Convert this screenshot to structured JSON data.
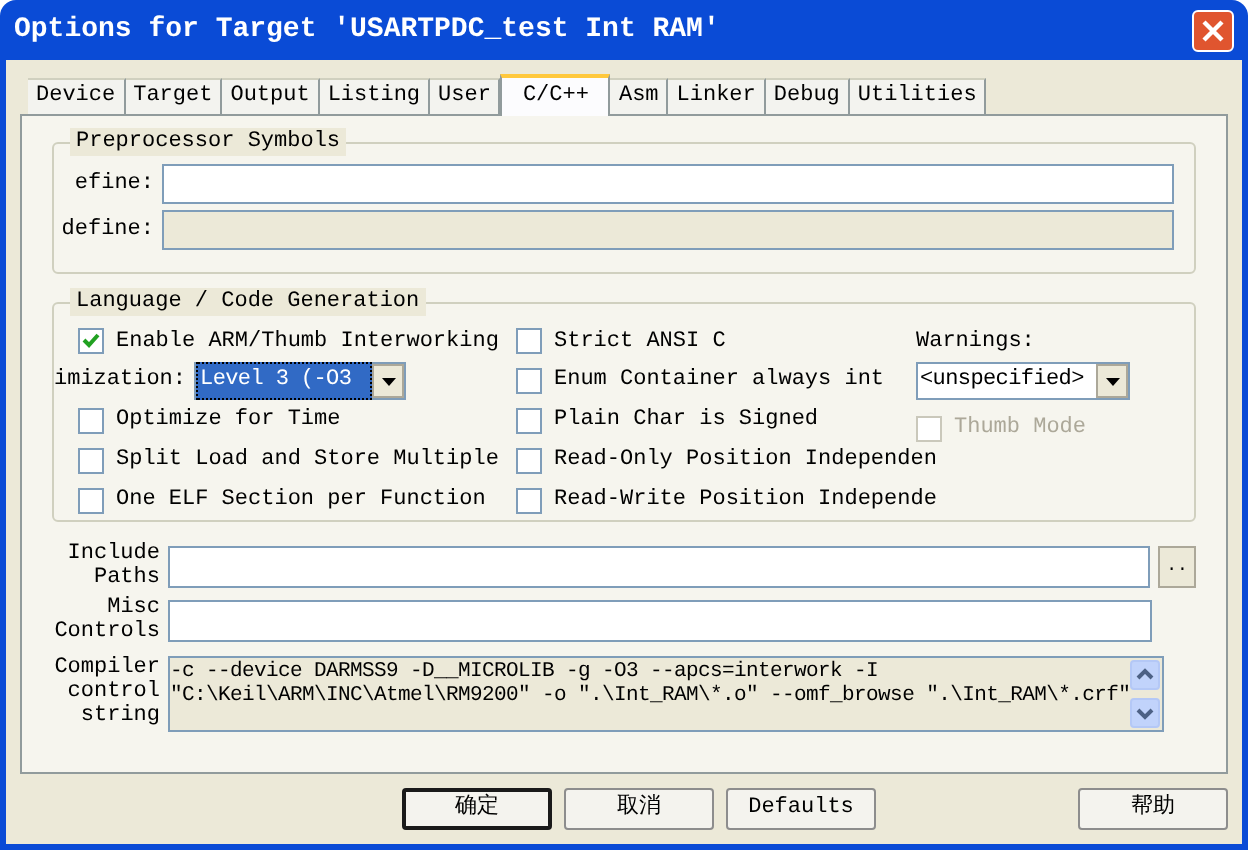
{
  "window": {
    "title": "Options for Target 'USARTPDC_test Int RAM'"
  },
  "tabs": [
    {
      "label": "Device",
      "selected": false
    },
    {
      "label": "Target",
      "selected": false
    },
    {
      "label": "Output",
      "selected": false
    },
    {
      "label": "Listing",
      "selected": false
    },
    {
      "label": "User",
      "selected": false
    },
    {
      "label": "C/C++",
      "selected": true
    },
    {
      "label": "Asm",
      "selected": false
    },
    {
      "label": "Linker",
      "selected": false
    },
    {
      "label": "Debug",
      "selected": false
    },
    {
      "label": "Utilities",
      "selected": false
    }
  ],
  "preprocessor": {
    "title": "Preprocessor Symbols",
    "fields": [
      {
        "label": "efine:",
        "disabled": false
      },
      {
        "label": "define:",
        "disabled": true
      }
    ]
  },
  "language": {
    "title": "Language / Code Generation",
    "left_options": [
      {
        "label": "Enable ARM/Thumb Interworking",
        "checked": true
      }
    ],
    "optimization": {
      "label": "imization:",
      "value": "Level 3 (-O3"
    },
    "left_options_2": [
      {
        "label": "Optimize for Time",
        "checked": false
      },
      {
        "label": "Split Load and Store Multiple",
        "checked": false
      },
      {
        "label": "One ELF Section per Function",
        "checked": false
      }
    ],
    "middle_options": [
      {
        "label": "Strict ANSI C",
        "checked": false
      },
      {
        "label": "Enum Container always int",
        "checked": false
      },
      {
        "label": "Plain Char is Signed",
        "checked": false
      },
      {
        "label": "Read-Only Position Independen",
        "checked": false
      },
      {
        "label": "Read-Write Position Independe",
        "checked": false
      }
    ],
    "warnings": {
      "label": "Warnings:",
      "value": "<unspecified>"
    },
    "thumb_mode": {
      "label": "Thumb Mode",
      "checked": false,
      "disabled": true
    }
  },
  "include_paths": {
    "label_lines": [
      "Include",
      "Paths"
    ],
    "browse": ".."
  },
  "misc_controls": {
    "label_lines": [
      "Misc",
      "Controls"
    ]
  },
  "compiler_string": {
    "label_lines": [
      "Compiler",
      "control",
      "string"
    ],
    "lines": [
      "-c --device DARMSS9 -D__MICROLIB -g -O3 --apcs=interwork -I",
      "\"C:\\Keil\\ARM\\INC\\Atmel\\RM9200\" -o \".\\Int_RAM\\*.o\" --omf_browse \".\\Int_RAM\\*.crf\""
    ]
  },
  "buttons": [
    {
      "label": "确定",
      "default": true
    },
    {
      "label": "取消",
      "default": false
    },
    {
      "label": "Defaults",
      "default": false
    },
    {
      "label": "帮助",
      "default": false
    }
  ]
}
